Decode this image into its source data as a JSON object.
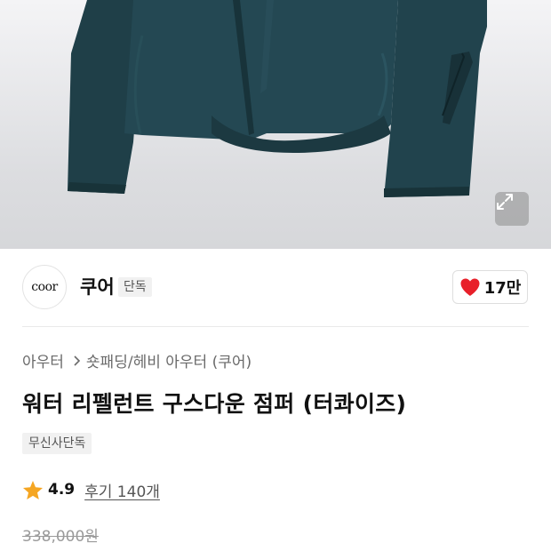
{
  "product_image": {
    "alt": "",
    "jacket_color": "#234750"
  },
  "expand_button": {
    "icon": "expand-icon"
  },
  "brand": {
    "logo_text": "coor",
    "name": "쿠어",
    "tag": "단독"
  },
  "like": {
    "icon": "heart-icon",
    "count": "17만",
    "color": "#e8202a"
  },
  "breadcrumb": {
    "items": [
      "아우터",
      "숏패딩/헤비 아우터 (쿠어)"
    ],
    "separator_icon": "chevron-right-icon"
  },
  "product": {
    "title": "워터 리펠런트 구스다운 점퍼 (터콰이즈)",
    "badge": "무신사단독",
    "rating": "4.9",
    "reviews": "후기 140개",
    "original_price": "338,000원"
  },
  "colors": {
    "star": "#f5a623",
    "heart": "#e8202a"
  }
}
